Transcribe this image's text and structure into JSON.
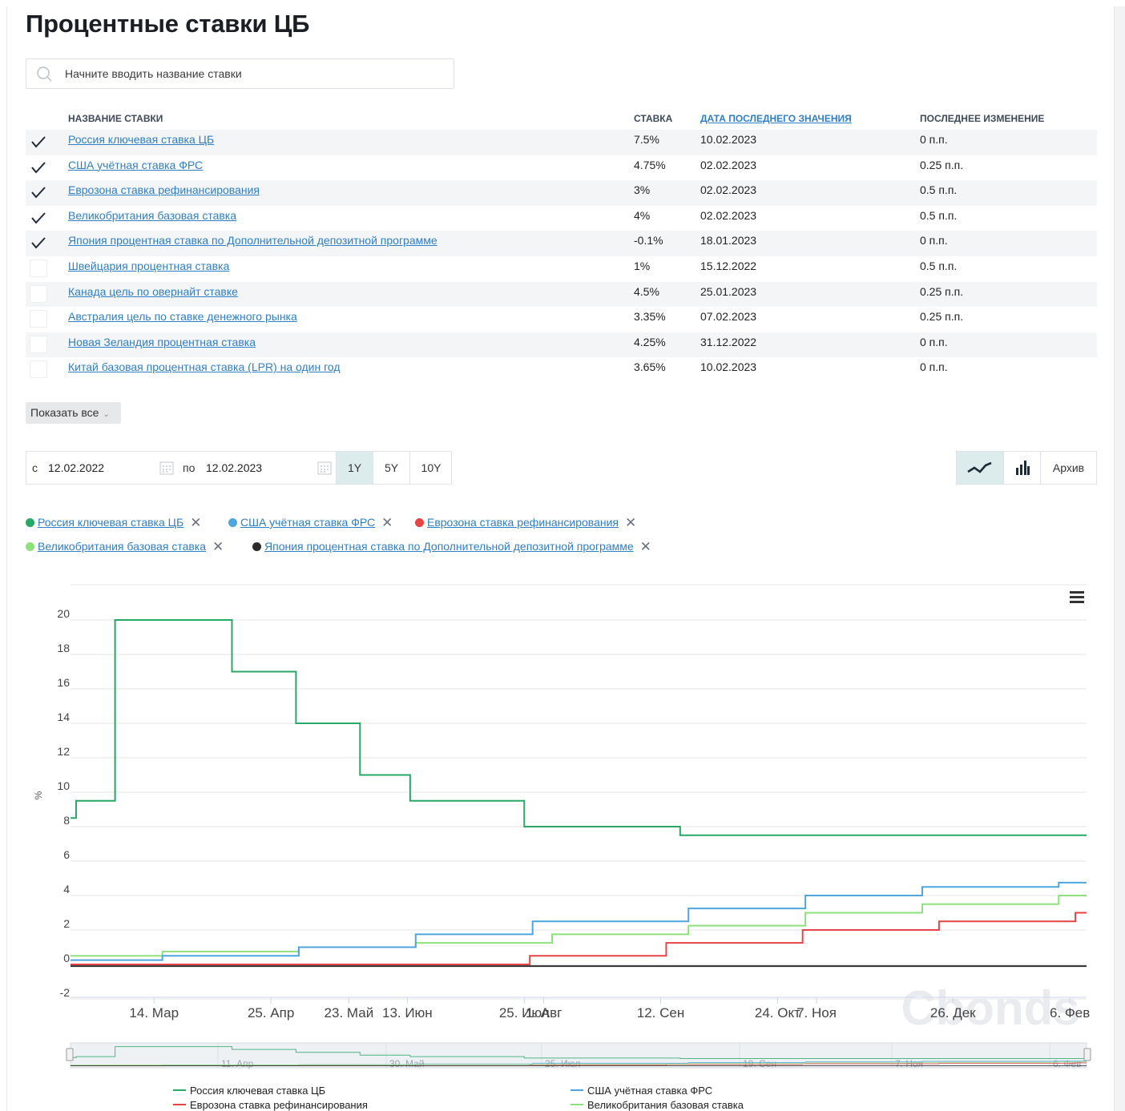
{
  "page": {
    "title": "Процентные ставки ЦБ"
  },
  "search": {
    "placeholder": "Начните вводить название ставки"
  },
  "table": {
    "headers": {
      "name": "НАЗВАНИЕ СТАВКИ",
      "rate": "СТАВКА",
      "date": "ДАТА ПОСЛЕДНЕГО ЗНАЧЕНИЯ",
      "change": "ПОСЛЕДНЕЕ ИЗМЕНЕНИЕ"
    },
    "rows": [
      {
        "checked": true,
        "name": "Россия ключевая ставка ЦБ",
        "rate": "7.5%",
        "date": "10.02.2023",
        "change": "0 п.п."
      },
      {
        "checked": true,
        "name": "США учётная ставка ФРС",
        "rate": "4.75%",
        "date": "02.02.2023",
        "change": "0.25 п.п."
      },
      {
        "checked": true,
        "name": "Еврозона ставка рефинансирования",
        "rate": "3%",
        "date": "02.02.2023",
        "change": "0.5 п.п."
      },
      {
        "checked": true,
        "name": "Великобритания базовая ставка",
        "rate": "4%",
        "date": "02.02.2023",
        "change": "0.5 п.п."
      },
      {
        "checked": true,
        "name": "Япония процентная ставка по Дополнительной депозитной программе",
        "rate": "-0.1%",
        "date": "18.01.2023",
        "change": "0 п.п."
      },
      {
        "checked": false,
        "name": "Швейцария процентная ставка",
        "rate": "1%",
        "date": "15.12.2022",
        "change": "0.5 п.п."
      },
      {
        "checked": false,
        "name": "Канада цель по овернайт ставке",
        "rate": "4.5%",
        "date": "25.01.2023",
        "change": "0.25 п.п."
      },
      {
        "checked": false,
        "name": "Австралия цель по ставке денежного рынка",
        "rate": "3.35%",
        "date": "07.02.2023",
        "change": "0.25 п.п."
      },
      {
        "checked": false,
        "name": "Новая Зеландия процентная ставка",
        "rate": "4.25%",
        "date": "31.12.2022",
        "change": "0 п.п."
      },
      {
        "checked": false,
        "name": "Китай базовая процентная ставка (LPR) на один год",
        "rate": "3.65%",
        "date": "10.02.2023",
        "change": "0 п.п."
      }
    ]
  },
  "show_all": {
    "label": "Показать все"
  },
  "date_range": {
    "from_label": "с",
    "from_value": "12.02.2022",
    "to_label": "по",
    "to_value": "12.02.2023",
    "periods": [
      "1Y",
      "5Y",
      "10Y"
    ],
    "active_period": "1Y"
  },
  "view": {
    "archive_label": "Архив",
    "active": "line"
  },
  "selected_series": [
    {
      "name": "Россия ключевая ставка ЦБ",
      "color": "#27a866"
    },
    {
      "name": "США учётная ставка ФРС",
      "color": "#4da6de"
    },
    {
      "name": "Еврозона ставка рефинансирования",
      "color": "#e84343"
    },
    {
      "name": "Великобритания базовая ставка",
      "color": "#8ee07c"
    },
    {
      "name": "Япония процентная ставка по Дополнительной депозитной программе",
      "color": "#2b2b2b"
    }
  ],
  "watermark": "Cbonds",
  "chart_data": {
    "type": "line",
    "step": true,
    "ylabel": "%",
    "ylim": [
      -2,
      21
    ],
    "yticks": [
      -2,
      0,
      2,
      4,
      6,
      8,
      10,
      12,
      14,
      16,
      18,
      20
    ],
    "xlim": [
      "2022-02-12",
      "2023-02-12"
    ],
    "xticks": [
      {
        "date": "2022-03-14",
        "label": "14. Мар"
      },
      {
        "date": "2022-04-25",
        "label": "25. Апр"
      },
      {
        "date": "2022-05-23",
        "label": "23. Май"
      },
      {
        "date": "2022-06-13",
        "label": "13. Июн"
      },
      {
        "date": "2022-07-25",
        "label": "25. Июл"
      },
      {
        "date": "2022-08-01",
        "label": "1. Авг"
      },
      {
        "date": "2022-09-12",
        "label": "12. Сен"
      },
      {
        "date": "2022-10-24",
        "label": "24. Окт"
      },
      {
        "date": "2022-11-07",
        "label": "7. Ноя"
      },
      {
        "date": "2022-12-26",
        "label": "26. Дек"
      },
      {
        "date": "2023-02-06",
        "label": "6. Фев"
      }
    ],
    "grid": true,
    "navigator_labels": [
      "11. Апр",
      "30. Май",
      "25. Июл",
      "19. Сен",
      "7. Ноя",
      "6. Фев"
    ],
    "series": [
      {
        "name": "Россия ключевая ставка ЦБ",
        "color": "#27a866",
        "points": [
          [
            "2022-02-12",
            8.5
          ],
          [
            "2022-02-14",
            9.5
          ],
          [
            "2022-02-28",
            20
          ],
          [
            "2022-04-11",
            17
          ],
          [
            "2022-05-04",
            14
          ],
          [
            "2022-05-27",
            11
          ],
          [
            "2022-06-14",
            9.5
          ],
          [
            "2022-07-25",
            8
          ],
          [
            "2022-09-19",
            7.5
          ],
          [
            "2023-02-12",
            7.5
          ]
        ]
      },
      {
        "name": "США учётная ставка ФРС",
        "color": "#4da6de",
        "points": [
          [
            "2022-02-12",
            0.25
          ],
          [
            "2022-03-17",
            0.5
          ],
          [
            "2022-05-05",
            1.0
          ],
          [
            "2022-06-16",
            1.75
          ],
          [
            "2022-07-28",
            2.5
          ],
          [
            "2022-09-22",
            3.25
          ],
          [
            "2022-11-03",
            4.0
          ],
          [
            "2022-12-15",
            4.5
          ],
          [
            "2023-02-02",
            4.75
          ],
          [
            "2023-02-12",
            4.75
          ]
        ]
      },
      {
        "name": "Еврозона ставка рефинансирования",
        "color": "#e84343",
        "points": [
          [
            "2022-02-12",
            0
          ],
          [
            "2022-07-27",
            0.5
          ],
          [
            "2022-09-14",
            1.25
          ],
          [
            "2022-11-02",
            2.0
          ],
          [
            "2022-12-21",
            2.5
          ],
          [
            "2023-02-08",
            3.0
          ],
          [
            "2023-02-12",
            3.0
          ]
        ]
      },
      {
        "name": "Великобритания базовая ставка",
        "color": "#8ee07c",
        "points": [
          [
            "2022-02-12",
            0.5
          ],
          [
            "2022-03-17",
            0.75
          ],
          [
            "2022-05-05",
            1.0
          ],
          [
            "2022-06-16",
            1.25
          ],
          [
            "2022-08-04",
            1.75
          ],
          [
            "2022-09-22",
            2.25
          ],
          [
            "2022-11-03",
            3.0
          ],
          [
            "2022-12-15",
            3.5
          ],
          [
            "2023-02-02",
            4.0
          ],
          [
            "2023-02-12",
            4.0
          ]
        ]
      },
      {
        "name": "Япония процентная ставка по Дополнительной депозитной программе",
        "color": "#2b2b2b",
        "points": [
          [
            "2022-02-12",
            -0.1
          ],
          [
            "2023-02-12",
            -0.1
          ]
        ]
      }
    ],
    "legend": [
      "Россия ключевая ставка ЦБ",
      "США учётная ставка ФРС",
      "Еврозона ставка рефинансирования",
      "Великобритания базовая ставка"
    ],
    "legend_placement": "bottom"
  }
}
